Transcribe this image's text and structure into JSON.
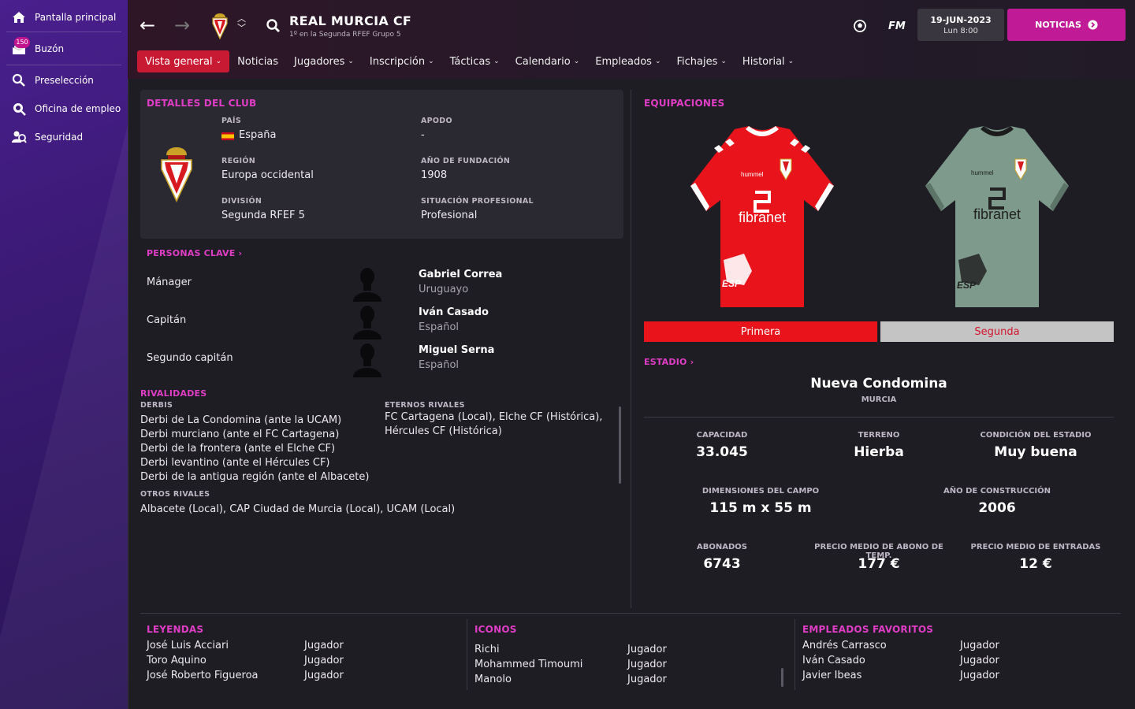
{
  "sidebar": {
    "items": [
      {
        "label": "Pantalla principal",
        "icon": "home-icon"
      },
      {
        "label": "Buzón",
        "icon": "inbox-icon",
        "badge": "150"
      },
      {
        "label": "Preselección",
        "icon": "search-icon"
      },
      {
        "label": "Oficina de empleo",
        "icon": "job-office-icon"
      },
      {
        "label": "Seguridad",
        "icon": "security-icon"
      }
    ]
  },
  "header": {
    "club_name": "REAL MURCIA CF",
    "club_subtitle": "1º en la Segunda RFEF Grupo 5",
    "fm_label": "FM",
    "date": "19-JUN-2023",
    "time": "Lun 8:00",
    "news_button": "NOTICIAS"
  },
  "tabs": [
    {
      "label": "Vista general",
      "active": true,
      "dropdown": true
    },
    {
      "label": "Noticias",
      "active": false,
      "dropdown": false
    },
    {
      "label": "Jugadores",
      "active": false,
      "dropdown": true
    },
    {
      "label": "Inscripción",
      "active": false,
      "dropdown": true
    },
    {
      "label": "Tácticas",
      "active": false,
      "dropdown": true
    },
    {
      "label": "Calendario",
      "active": false,
      "dropdown": true
    },
    {
      "label": "Empleados",
      "active": false,
      "dropdown": true
    },
    {
      "label": "Fichajes",
      "active": false,
      "dropdown": true
    },
    {
      "label": "Historial",
      "active": false,
      "dropdown": true
    }
  ],
  "club_details": {
    "title": "DETALLES DEL CLUB",
    "country_label": "PAÍS",
    "country": "España",
    "nickname_label": "APODO",
    "nickname": "-",
    "region_label": "REGIÓN",
    "region": "Europa occidental",
    "founded_label": "AÑO DE FUNDACIÓN",
    "founded": "1908",
    "division_label": "DIVISIÓN",
    "division": "Segunda RFEF 5",
    "status_label": "SITUACIÓN PROFESIONAL",
    "status": "Profesional"
  },
  "key_people": {
    "title": "PERSONAS CLAVE",
    "people": [
      {
        "role": "Mánager",
        "name": "Gabriel Correa",
        "nationality": "Uruguayo"
      },
      {
        "role": "Capitán",
        "name": "Iván Casado",
        "nationality": "Español"
      },
      {
        "role": "Segundo capitán",
        "name": "Miguel Serna",
        "nationality": "Español"
      }
    ]
  },
  "rivalries": {
    "title": "RIVALIDADES",
    "derbies_label": "DERBIS",
    "derbies": [
      "Derbi de La Condomina (ante la UCAM)",
      "Derbi murciano (ante el FC Cartagena)",
      "Derbi de la frontera (ante el Elche CF)",
      "Derbi levantino (ante el Hércules CF)",
      "Derbi de la antigua región (ante el Albacete)"
    ],
    "eternal_label": "ETERNOS RIVALES",
    "eternal_lines": [
      "FC Cartagena (Local), Elche CF (Histórica),",
      "Hércules CF (Histórica)"
    ],
    "others_label": "OTROS RIVALES",
    "others": "Albacete (Local), CAP Ciudad de Murcia (Local), UCAM (Local)"
  },
  "kits": {
    "title": "EQUIPACIONES",
    "home_label": "Primera",
    "away_label": "Segunda",
    "sponsor": "fibranet",
    "home_color": "#e8131b",
    "away_color": "#7d9a8c"
  },
  "stadium": {
    "title": "ESTADIO",
    "name": "Nueva Condomina",
    "city": "MURCIA",
    "capacity_label": "CAPACIDAD",
    "capacity": "33.045",
    "surface_label": "TERRENO",
    "surface": "Hierba",
    "condition_label": "CONDICIÓN DEL ESTADIO",
    "condition": "Muy buena",
    "dimensions_label": "DIMENSIONES DEL CAMPO",
    "dimensions": "115 m x 55 m",
    "built_label": "AÑO DE CONSTRUCCIÓN",
    "built": "2006",
    "season_tickets_label": "ABONADOS",
    "season_tickets": "6743",
    "avg_season_price_label": "PRECIO MEDIO DE ABONO DE TEMP.",
    "avg_season_price": "177 €",
    "avg_ticket_price_label": "PRECIO MEDIO DE ENTRADAS",
    "avg_ticket_price": "12 €"
  },
  "legends": {
    "title": "LEYENDAS",
    "rows": [
      {
        "name": "José Luis Acciari",
        "type": "Jugador"
      },
      {
        "name": "Toro Aquino",
        "type": "Jugador"
      },
      {
        "name": "José Roberto Figueroa",
        "type": "Jugador"
      }
    ]
  },
  "icons": {
    "title": "ICONOS",
    "rows": [
      {
        "name": "Richi",
        "type": "Jugador"
      },
      {
        "name": "Mohammed Timoumi",
        "type": "Jugador"
      },
      {
        "name": "Manolo",
        "type": "Jugador"
      }
    ]
  },
  "favourite_staff": {
    "title": "EMPLEADOS FAVORITOS",
    "rows": [
      {
        "name": "Andrés Carrasco",
        "type": "Jugador"
      },
      {
        "name": "Iván Casado",
        "type": "Jugador"
      },
      {
        "name": "Javier Ibeas",
        "type": "Jugador"
      }
    ]
  }
}
